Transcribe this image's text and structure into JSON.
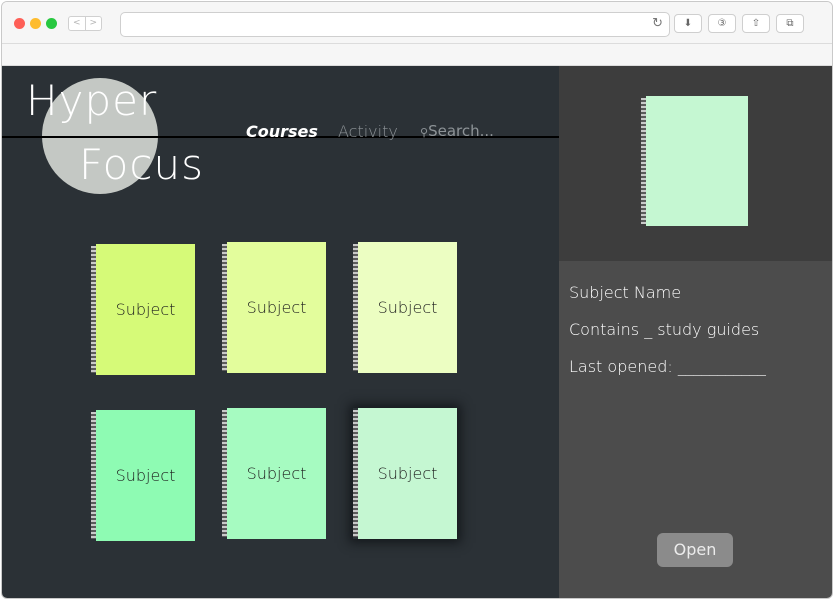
{
  "browser": {
    "nav_back": "<",
    "nav_forward": ">",
    "reload_glyph": "↻",
    "toolbar_glyphs": [
      "⬇",
      "③",
      "⇧",
      "⧉"
    ]
  },
  "logo": {
    "line1": "Hyper",
    "line2": "Focus"
  },
  "nav": {
    "courses": "Courses",
    "activity": "Activity",
    "search_icon": "⚲",
    "search": "Search..."
  },
  "subjects": [
    {
      "label": "Subject",
      "color": "#d6fa78"
    },
    {
      "label": "Subject",
      "color": "#e3fd9c"
    },
    {
      "label": "Subject",
      "color": "#ecfec2"
    },
    {
      "label": "Subject",
      "color": "#8efbb3"
    },
    {
      "label": "Subject",
      "color": "#a6fbc1"
    },
    {
      "label": "Subject",
      "color": "#c5f7d2"
    }
  ],
  "selected_subject_index": 5,
  "details": {
    "name": "Subject Name",
    "contains": "Contains _ study guides",
    "last_opened": "Last opened: ___________",
    "open_button": "Open"
  },
  "colors": {
    "main_bg": "#2b3136",
    "side_top_bg": "#3d3d3d",
    "side_bottom_bg": "#4c4c4c",
    "logo_circle": "#c4c8c4"
  }
}
